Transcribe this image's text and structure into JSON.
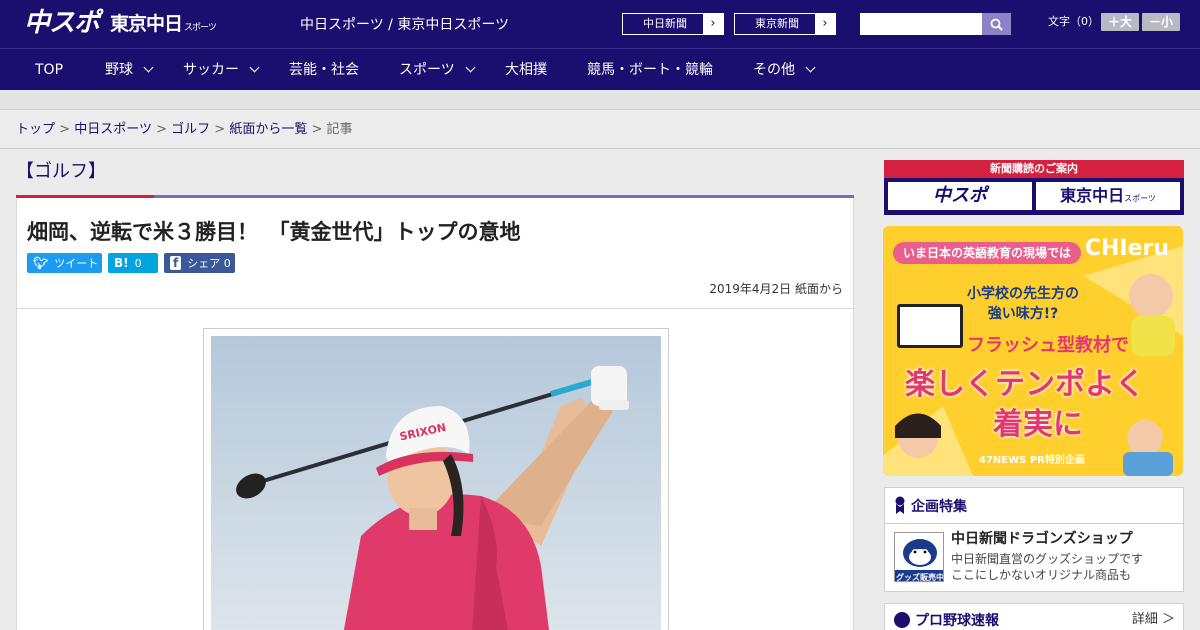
{
  "header": {
    "logo_chuspo": "中スポ",
    "logo_tokyo": "東京中日",
    "logo_tokyo_sub": "スポーツ",
    "site_name": "中日スポーツ / 東京中日スポーツ",
    "paper_links": [
      "中日新聞",
      "東京新聞"
    ],
    "search_placeholder": "",
    "font_size_label": "文字（0）",
    "font_up": "＋大",
    "font_down": "－小"
  },
  "nav": {
    "items": [
      {
        "label": "TOP",
        "has_menu": false
      },
      {
        "label": "野球",
        "has_menu": true
      },
      {
        "label": "サッカー",
        "has_menu": true
      },
      {
        "label": "芸能・社会",
        "has_menu": false
      },
      {
        "label": "スポーツ",
        "has_menu": true
      },
      {
        "label": "大相撲",
        "has_menu": false
      },
      {
        "label": "競馬・ボート・競輪",
        "has_menu": false
      },
      {
        "label": "その他",
        "has_menu": true
      }
    ]
  },
  "breadcrumb": {
    "items": [
      "トップ",
      "中日スポーツ",
      "ゴルフ",
      "紙面から一覧"
    ],
    "current": "記事",
    "separator": ">"
  },
  "article": {
    "section": "【ゴルフ】",
    "headline": "畑岡、逆転で米３勝目！　「黄金世代」トップの意地",
    "share": {
      "tweet": "ツイート",
      "hatena_count": "0",
      "facebook": "シェア",
      "facebook_count": "0"
    },
    "date": "2019年4月2日 紙面から",
    "photo_cap_text": "SRIXON"
  },
  "sidebar": {
    "subscription": {
      "title": "新聞購読のご案内",
      "logo1": "中スポ",
      "logo2": "東京中日",
      "logo2_sub": "スポーツ"
    },
    "ad": {
      "top": "いま日本の英語教育の現場では",
      "brand": "CHIeru",
      "sub1": "小学校の先生方の",
      "sub2": "強い味方!?",
      "pink": "フラッシュ型教材で",
      "big1": "楽しくテンポよく",
      "big2": "着実に",
      "foot": "47NEWS PR特別企画"
    },
    "feature": {
      "title": "企画特集",
      "shop_title": "中日新聞ドラゴンズショップ",
      "shop_desc1": "中日新聞直営のグッズショップです",
      "shop_desc2": "ここにしかないオリジナル商品も",
      "thumb_label": "グッズ販売中"
    },
    "baseball": {
      "title": "プロ野球速報",
      "detail": "詳細 ＞"
    }
  },
  "colors": {
    "brand_navy": "#1a0e6e",
    "accent_red": "#d5203f",
    "accent_purple": "#7a6fb4",
    "twitter": "#1d9bf0",
    "hatena": "#00a4de",
    "facebook": "#3b5998"
  }
}
